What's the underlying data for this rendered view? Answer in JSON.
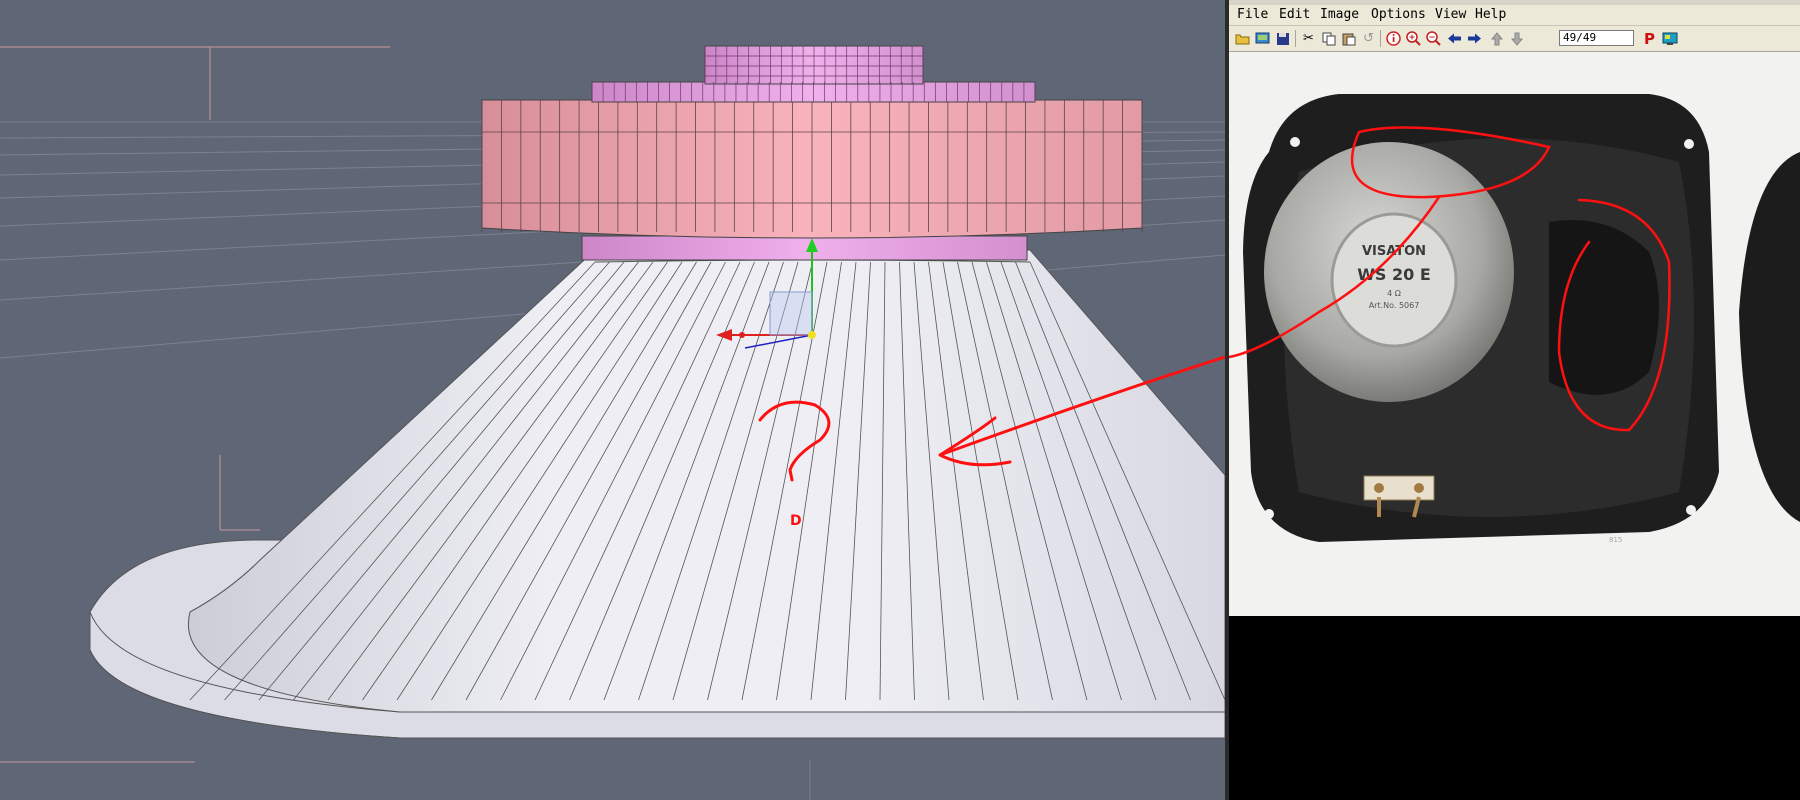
{
  "viewport": {
    "annotation_question": "?",
    "annotation_small": "D"
  },
  "viewer": {
    "menu": [
      "File",
      "Edit",
      "Image",
      "Options",
      "View",
      "Help"
    ],
    "toolbar": {
      "page_indicator": "49/49",
      "icons": [
        "open-folder-icon",
        "slideshow-icon",
        "save-icon",
        "cut-icon",
        "copy-icon",
        "paste-icon",
        "undo-icon",
        "info-icon",
        "zoom-in-icon",
        "zoom-out-icon",
        "prev-arrow-icon",
        "next-arrow-icon",
        "first-icon",
        "last-icon",
        "print-icon",
        "screen-icon"
      ]
    },
    "photo": {
      "brand": "VISATON",
      "model": "WS 20 E",
      "ohm": "4 Ω",
      "art_no": "Art.No. 5067",
      "corner_mark": "815"
    }
  },
  "colors": {
    "viewport_bg": "#5f6776",
    "cone_fill": "#e6e6ee",
    "magnet_fill": "#f2a3ad",
    "top_fill": "#e6a0e0",
    "annotation_red": "#ff1010",
    "viewer_bar": "#ece9d8"
  }
}
